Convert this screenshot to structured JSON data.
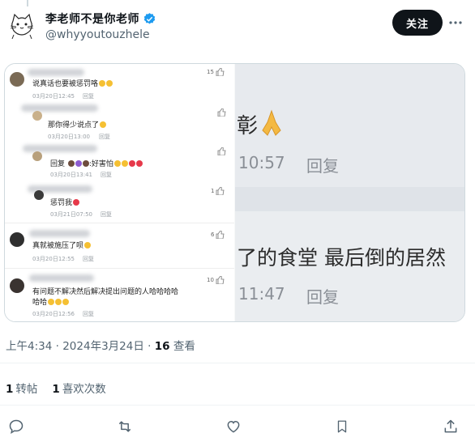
{
  "author": {
    "display_name": "李老师不是你老师",
    "handle": "@whyyoutouzhele",
    "verified": true
  },
  "header": {
    "follow_label": "关注",
    "more_icon": "more-horizontal-icon"
  },
  "media": {
    "left": {
      "comments": [
        {
          "text": "说真话也要被惩罚咯",
          "date": "03月20日12:45",
          "reply": "回复",
          "likes": "15"
        },
        {
          "text": "那你得少说点了",
          "date": "03月20日13:00",
          "reply": "回复",
          "likes": ""
        },
        {
          "text": "回复",
          "text2": ":好害怕",
          "date": "03月20日13:41",
          "reply": "回复",
          "likes": ""
        },
        {
          "text": "惩罚我",
          "date": "03月21日07:50",
          "reply": "回复",
          "likes": "1"
        },
        {
          "text": "真就被施压了呗",
          "date": "03月20日12:55",
          "reply": "回复",
          "likes": "6"
        },
        {
          "text": "有问题不解决然后解决提出问题的人哈哈哈哈",
          "text_line2": "哈哈",
          "date": "03月20日12:56",
          "reply": "回复",
          "likes": "10"
        }
      ]
    },
    "right": {
      "top_char": "彰",
      "top_time": "10:57",
      "top_reply": "回复",
      "bottom_text": "了的食堂 最后倒的居然",
      "bottom_time": "11:47",
      "bottom_reply": "回复"
    }
  },
  "meta": {
    "time": "上午4:34",
    "separator": "·",
    "date": "2024年3月24日",
    "views_count": "16",
    "views_label": "查看"
  },
  "stats": {
    "retweets_count": "1",
    "retweets_label": "转帖",
    "likes_count": "1",
    "likes_label": "喜欢次数"
  },
  "actions": [
    "reply-icon",
    "retweet-icon",
    "like-icon",
    "bookmark-icon",
    "share-icon"
  ]
}
